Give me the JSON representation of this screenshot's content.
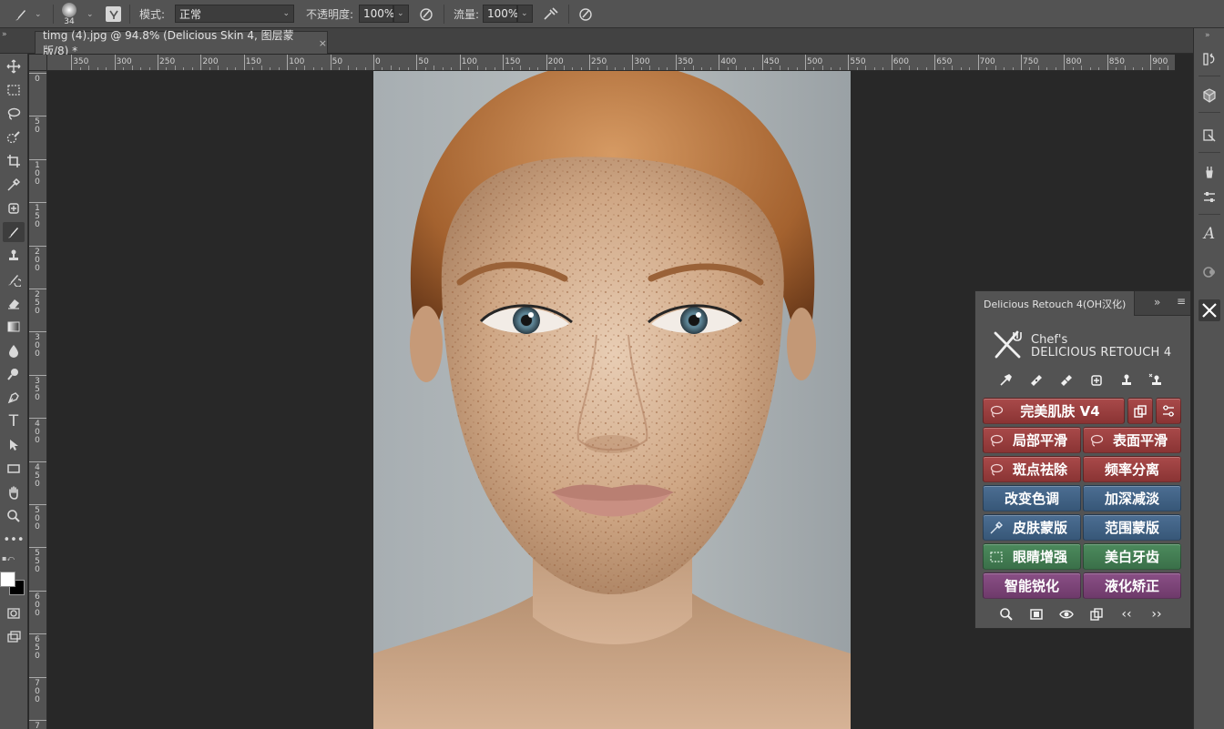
{
  "options_bar": {
    "brush_size": "34",
    "mode_label": "模式:",
    "mode_value": "正常",
    "opacity_label": "不透明度:",
    "opacity_value": "100%",
    "flow_label": "流量:",
    "flow_value": "100%"
  },
  "document_tab": {
    "title": "timg (4).jpg @ 94.8% (Delicious Skin 4, 图层蒙版/8) *",
    "close": "×"
  },
  "ruler_top": {
    "labels": [
      "350",
      "300",
      "250",
      "200",
      "150",
      "100",
      "50",
      "0",
      "50",
      "100",
      "150",
      "200",
      "250",
      "300",
      "350",
      "400",
      "450",
      "500",
      "550",
      "600",
      "650",
      "700",
      "750",
      "800",
      "850",
      "900"
    ]
  },
  "ruler_left": {
    "labels": [
      "0",
      "50",
      "100",
      "150",
      "200",
      "250",
      "300",
      "350",
      "400",
      "450",
      "500",
      "550",
      "600",
      "650",
      "700",
      "7"
    ]
  },
  "panel": {
    "title": "Delicious Retouch 4(OH汉化)",
    "collapse": "»",
    "brand_line1": "Chef's",
    "brand_line2": "DELICIOUS RETOUCH 4",
    "buttons": {
      "perfect_skin": "完美肌肤 V4",
      "local_smooth": "局部平滑",
      "surface_smooth": "表面平滑",
      "spot_remove": "斑点祛除",
      "freq_sep": "频率分离",
      "change_tone": "改变色调",
      "dodge_burn": "加深减淡",
      "skin_mask": "皮肤蒙版",
      "range_mask": "范围蒙版",
      "eye_enhance": "眼睛增强",
      "teeth_whiten": "美白牙齿",
      "smart_sharpen": "智能锐化",
      "liquify": "液化矫正"
    },
    "bottom_nav": {
      "prev": "‹‹",
      "next": "››"
    }
  },
  "colors": {
    "red": "#9c3f3f",
    "blue": "#426283",
    "green": "#437d53",
    "purple": "#7c4479"
  }
}
